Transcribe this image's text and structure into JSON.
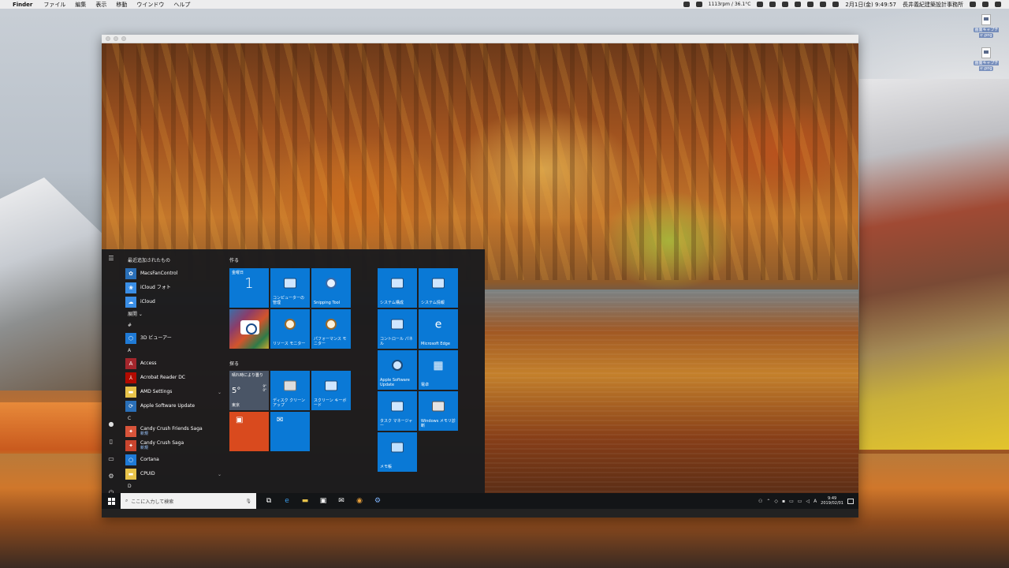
{
  "menubar": {
    "app_name": "Finder",
    "items": [
      "ファイル",
      "編集",
      "表示",
      "移動",
      "ウインドウ",
      "ヘルプ"
    ],
    "fan_stats": "1113rpm / 36.1°C",
    "datetime": "2月1日(金)  9:49:57",
    "user": "長井義紀建築設計事務所"
  },
  "desktop_files": [
    {
      "name": "画面キャプチャ.png"
    },
    {
      "name": "画面キャプチャ.png"
    }
  ],
  "start_menu": {
    "recent_header": "最近追加されたもの",
    "recent_apps": [
      {
        "label": "MacsFanControl",
        "icon": "macs-fan-icon"
      },
      {
        "label": "iCloud フォト",
        "icon": "icloud-photos-icon"
      },
      {
        "label": "iCloud",
        "icon": "icloud-icon"
      }
    ],
    "expand_label": "展開 ⌄",
    "sections": [
      {
        "letter": "#",
        "apps": [
          {
            "label": "3D ビューアー",
            "sub": ""
          }
        ]
      },
      {
        "letter": "A",
        "apps": [
          {
            "label": "Access",
            "sub": ""
          },
          {
            "label": "Acrobat Reader DC",
            "sub": ""
          },
          {
            "label": "AMD Settings",
            "sub": ""
          },
          {
            "label": "Apple Software Update",
            "sub": ""
          }
        ]
      },
      {
        "letter": "C",
        "apps": [
          {
            "label": "Candy Crush Friends Saga",
            "sub": "新規"
          },
          {
            "label": "Candy Crush Saga",
            "sub": "新規"
          },
          {
            "label": "Cortana",
            "sub": ""
          },
          {
            "label": "CPUID",
            "sub": ""
          }
        ]
      },
      {
        "letter": "D",
        "apps": []
      }
    ],
    "tile_groups": {
      "create": "作る",
      "explore": "探る"
    },
    "tiles": {
      "calendar_day": "金曜日",
      "calendar_num": "1",
      "computer_mgmt": "コンピューターの管理",
      "snipping_tool": "Snipping Tool",
      "resource_monitor": "リソース モニター",
      "performance_monitor": "パフォーマンス モニター",
      "weather_title": "晴れ時により曇り",
      "weather_temp": "5°",
      "weather_high": "9°",
      "weather_low": "0°",
      "weather_city": "東京",
      "disk_cleanup": "ディスク クリーンアップ",
      "onscreen_keyboard": "スクリーン キーボード",
      "system_config": "システム構成",
      "system_info": "システム情報",
      "control_panel": "コントロール パネル",
      "edge": "Microsoft Edge",
      "apple_sw_update": "Apple Software Update",
      "calculator": "電卓",
      "task_manager": "タスク マネージャー",
      "memory_diag": "Windows メモリ診断",
      "notepad": "メモ帳"
    }
  },
  "taskbar": {
    "search_placeholder": "ここに入力して検索",
    "ime": "A",
    "time": "9:49",
    "date": "2019/02/01"
  }
}
